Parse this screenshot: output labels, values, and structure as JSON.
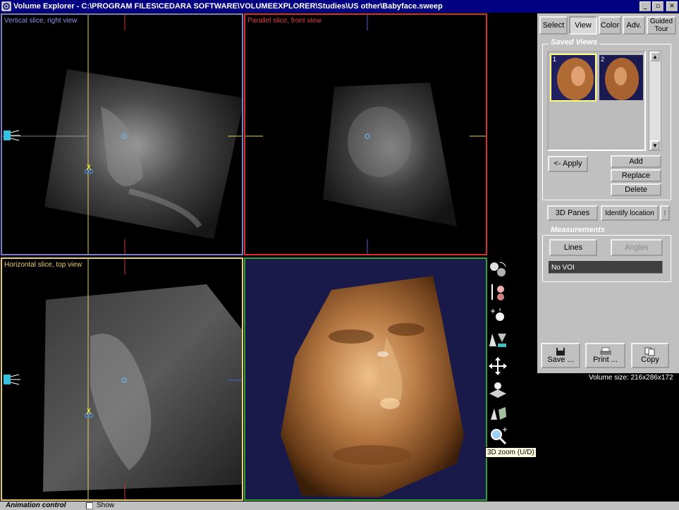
{
  "window": {
    "title": "Volume Explorer - C:\\PROGRAM FILES\\CEDARA SOFTWARE\\VOLUMEEXPLORER\\Studies\\US other\\Babyface.sweep",
    "minimize": "_",
    "maximize": "▫",
    "close": "✕"
  },
  "panes": {
    "top_left": {
      "label": "Vertical slice, right view",
      "border_color": "#7b7bd0"
    },
    "top_right": {
      "label": "Parallel slice, front view",
      "border_color": "#d43030"
    },
    "bottom_left": {
      "label": "Horizontal slice, top view",
      "border_color": "#e8d070"
    },
    "bottom_right": {
      "border_color": "#2fa030"
    }
  },
  "tabs": [
    {
      "label": "Select",
      "active": false
    },
    {
      "label": "View",
      "active": true
    },
    {
      "label": "Color",
      "active": false
    },
    {
      "label": "Adv.",
      "active": false
    },
    {
      "label": "Guided Tour",
      "active": false
    }
  ],
  "saved_views": {
    "title": "Saved Views",
    "thumbnails": [
      {
        "number": "1",
        "selected": true
      },
      {
        "number": "2",
        "selected": false
      }
    ],
    "apply_label": "<- Apply",
    "add_label": "Add",
    "replace_label": "Replace",
    "delete_label": "Delete"
  },
  "panes_button": "3D Panes",
  "identify_button": "Identify location",
  "measurements": {
    "title": "Measurements",
    "lines_label": "Lines",
    "angles_label": "Angles",
    "status": "No VOI"
  },
  "actions": {
    "save_label": "Save ...",
    "print_label": "Print ...",
    "copy_label": "Copy"
  },
  "volume_size": "Volume size: 216x286x172",
  "tooltip": "3D zoom (U/D)",
  "tools": [
    "rotate-head-icon",
    "light-source-icon",
    "light-intensity-icon",
    "opacity-icon",
    "move-icon",
    "plane-icon",
    "cut-tool-icon",
    "zoom-3d-icon"
  ],
  "animation": {
    "label": "Animation control",
    "show_label": "Show",
    "show_checked": false
  },
  "colors": {
    "accent": "#000080",
    "panel": "#c0c0c0",
    "selection": "#ffff80"
  }
}
